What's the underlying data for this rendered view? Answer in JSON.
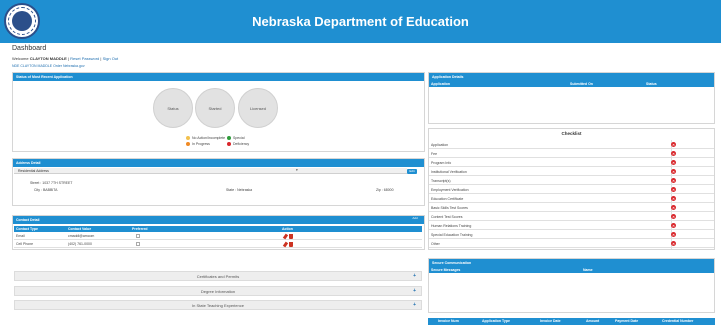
{
  "header": {
    "title": "Nebraska Department of Education",
    "seal_icon": "state-seal-icon"
  },
  "page": {
    "title": "Dashboard",
    "welcome_prefix": "Welcome",
    "user_name": "CLAYTON MADDLE",
    "reset_password": "Reset Password",
    "separator": "|",
    "sign_out": "Sign Out",
    "sub_welcome": "NDE CLAYTON MADDLE Order Nebraska.gov"
  },
  "status_panel": {
    "title": "Status of Most Recent Application",
    "circles": [
      "Status",
      "Started",
      "Licensed"
    ],
    "legend": [
      {
        "label": "No Action/Incomplete",
        "color": "#f2c14e"
      },
      {
        "label": "Special",
        "color": "#2e9c3a"
      },
      {
        "label": "In Progress",
        "color": "#f08a24"
      },
      {
        "label": "Deficiency",
        "color": "#d9262b"
      }
    ]
  },
  "address_panel": {
    "title": "Address Detail",
    "section": "Residential Address",
    "edit_label": "Edit",
    "street_label": "Street :",
    "street_value": "1037 7TH STREET",
    "city_label": "City :",
    "city_value": "BABBITA",
    "state_label": "State :",
    "state_value": "Nebraska",
    "zip_label": "Zip :",
    "zip_value": "68000"
  },
  "contact_panel": {
    "title": "Contact Detail",
    "add_label": "Add",
    "columns": [
      "Contact Type",
      "Contact Value",
      "Preferred",
      "Action"
    ],
    "rows": [
      {
        "type": "Email",
        "value": "cmaddl@amcom"
      },
      {
        "type": "Cell Phone",
        "value": "(402) 761-0000"
      }
    ]
  },
  "accordions": [
    {
      "label": "Certificates and Permits"
    },
    {
      "label": "Degree Information"
    },
    {
      "label": "In State Teaching Experience"
    }
  ],
  "application_panel": {
    "title": "Application Details",
    "columns": [
      "Application",
      "Submitted On",
      "Status"
    ]
  },
  "checklist": {
    "title": "Checklist",
    "items": [
      "Application",
      "Fee",
      "Program Info",
      "Institutional Verification",
      "Transcript(s)",
      "Employment Verification",
      "Education Certificate",
      "Basic Skills Test Scores",
      "Content Test Scores",
      "Human Relations Training",
      "Special Education Training",
      "Other"
    ]
  },
  "secure_panel": {
    "title": "Secure Communication",
    "columns": [
      "Secure Messages",
      "Name"
    ]
  },
  "invoice_table": {
    "columns": [
      "Invoice Num",
      "Application Type",
      "Invoice Date",
      "Amount",
      "Payment Date",
      "Credential Number"
    ]
  }
}
